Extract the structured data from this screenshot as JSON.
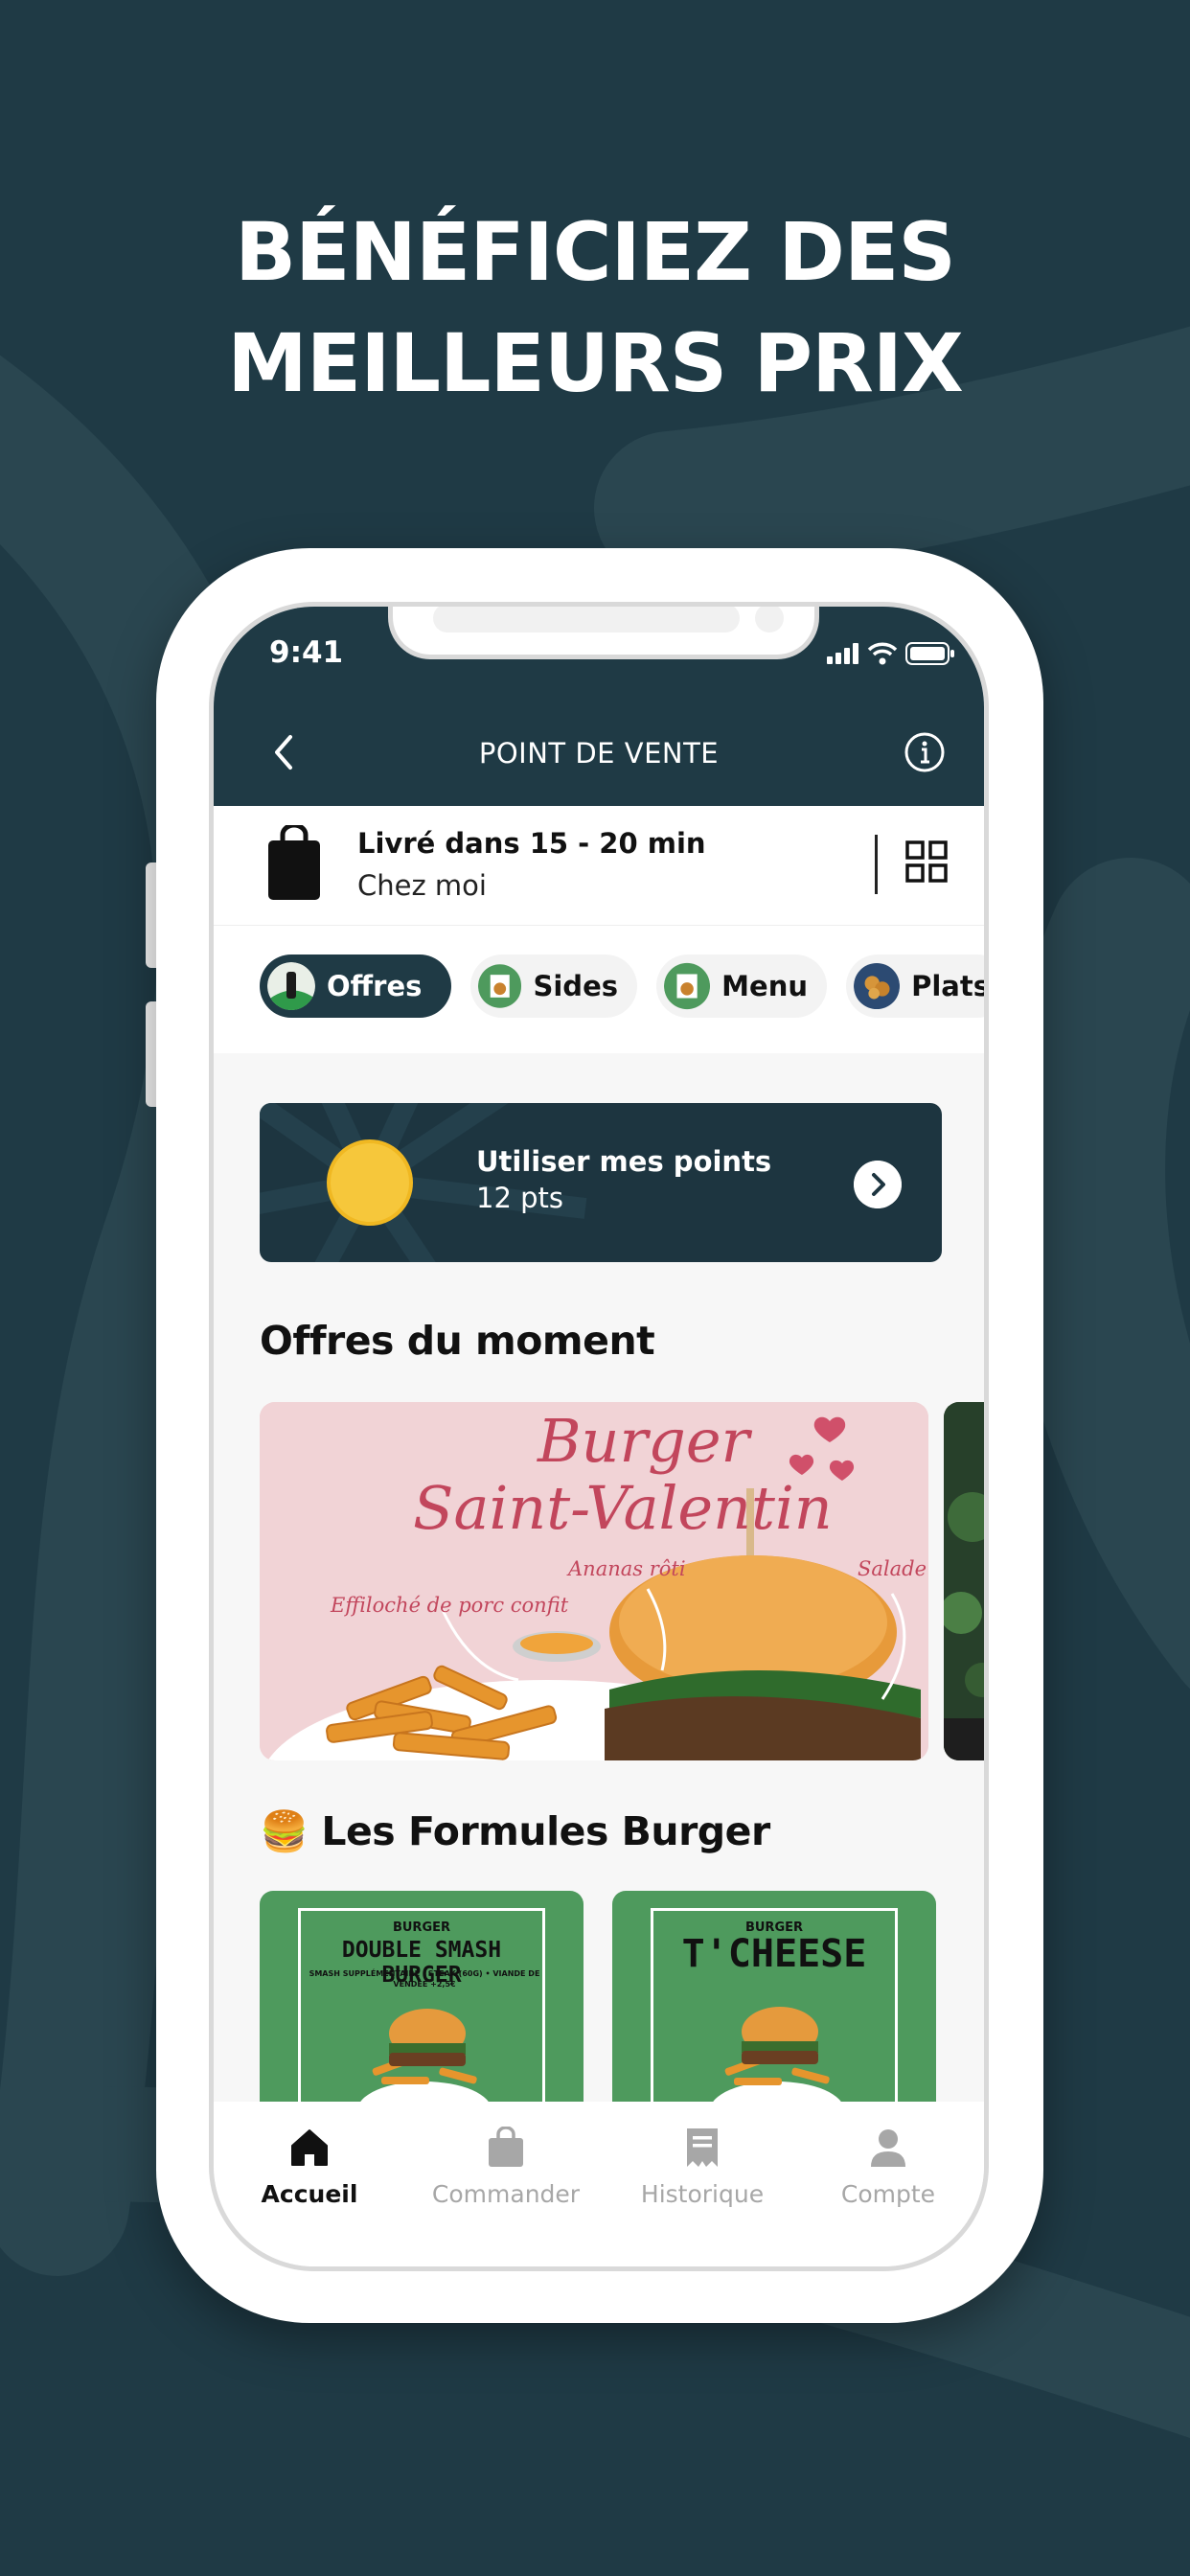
{
  "headline": {
    "line1": "BÉNÉFICIEZ DES",
    "line2": "MEILLEURS PRIX"
  },
  "status_bar": {
    "time": "9:41"
  },
  "nav": {
    "title": "POINT DE VENTE"
  },
  "delivery": {
    "title": "Livré dans 15 - 20 min",
    "subtitle": "Chez moi"
  },
  "chips": [
    {
      "label": "Offres",
      "active": true
    },
    {
      "label": "Sides",
      "active": false
    },
    {
      "label": "Menu",
      "active": false
    },
    {
      "label": "Plats",
      "active": false
    }
  ],
  "points": {
    "title": "Utiliser mes points",
    "value": "12 pts"
  },
  "offers": {
    "title": "Offres du moment",
    "promo": {
      "script_line1": "Burger",
      "script_line2": "Saint-Valentin",
      "label_left": "Effiloché de porc confit",
      "label_mid": "Ananas rôti",
      "label_right": "Salade"
    }
  },
  "formules": {
    "emoji": "🍔",
    "title": "Les Formules Burger",
    "cards": [
      {
        "small": "BURGER",
        "title": "DOUBLE SMASH BURGER",
        "note": "SMASH SUPPLÉMENTAIRE : STEAK (60G) • VIANDE DE VENDÉE +2,5€"
      },
      {
        "small": "BURGER",
        "title": "T'CHEESE",
        "note": ""
      }
    ]
  },
  "tabbar": [
    {
      "label": "Accueil",
      "active": true
    },
    {
      "label": "Commander",
      "active": false
    },
    {
      "label": "Historique",
      "active": false
    },
    {
      "label": "Compte",
      "active": false
    }
  ],
  "colors": {
    "primary": "#1f3a45",
    "sun": "#f6c73b",
    "green": "#4e9a5d",
    "promo_pink": "#f1d3d6",
    "script_red": "#c2465c"
  }
}
